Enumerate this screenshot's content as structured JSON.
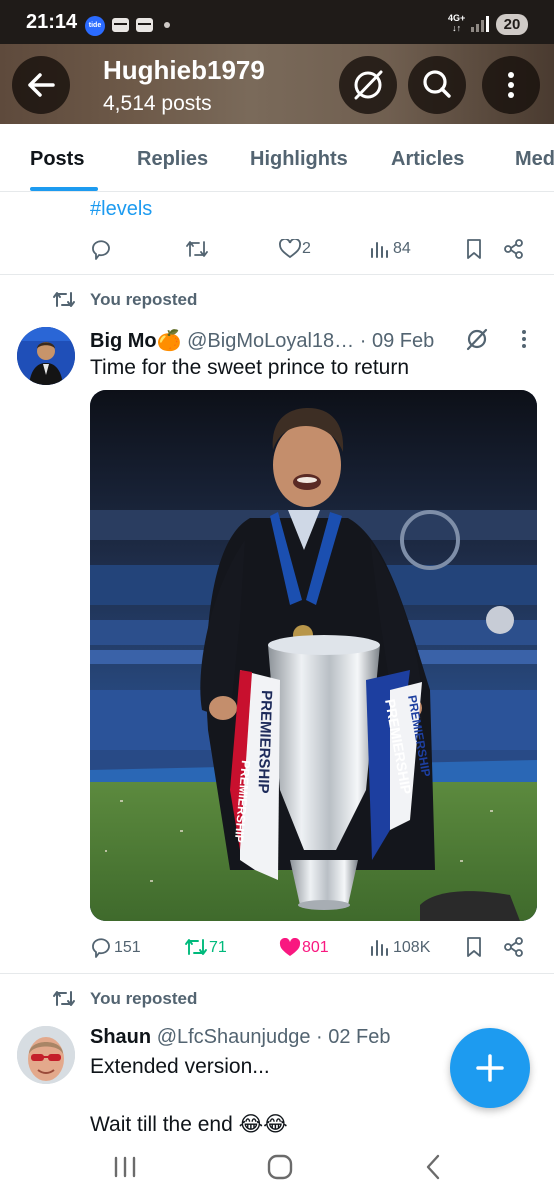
{
  "status_bar": {
    "time": "21:14",
    "tide_label": "tide",
    "network": "4G+",
    "battery": "20"
  },
  "header": {
    "username": "Hughieb1979",
    "post_count": "4,514 posts"
  },
  "tabs": [
    "Posts",
    "Replies",
    "Highlights",
    "Articles",
    "Media"
  ],
  "post1": {
    "hashtag": "#levels",
    "likes": "2",
    "views": "84"
  },
  "post2": {
    "repost_label": "You reposted",
    "author": "Big Mo🍊",
    "handle": "@BigMoLoyal18…",
    "date": "· 09 Feb",
    "text": "Time for the sweet prince to return",
    "ribbon_text": "PREMIERSHIP",
    "replies": "151",
    "reposts": "71",
    "likes": "801",
    "views": "108K"
  },
  "post3": {
    "repost_label": "You reposted",
    "author": "Shaun",
    "handle": "@LfcShaunjudge",
    "date": "· 02 Feb",
    "text_line1": "Extended version...",
    "text_line2": "Wait till the end 😂😂"
  },
  "colors": {
    "accent": "#1d9bf0",
    "like": "#f91880",
    "repost": "#00ba7c",
    "secondary": "#536471"
  },
  "icons": [
    "back-arrow-icon",
    "no-sync-icon",
    "search-icon",
    "more-vertical-icon",
    "reply-icon",
    "repost-icon",
    "like-icon",
    "views-icon",
    "bookmark-icon",
    "share-icon",
    "plus-icon"
  ]
}
